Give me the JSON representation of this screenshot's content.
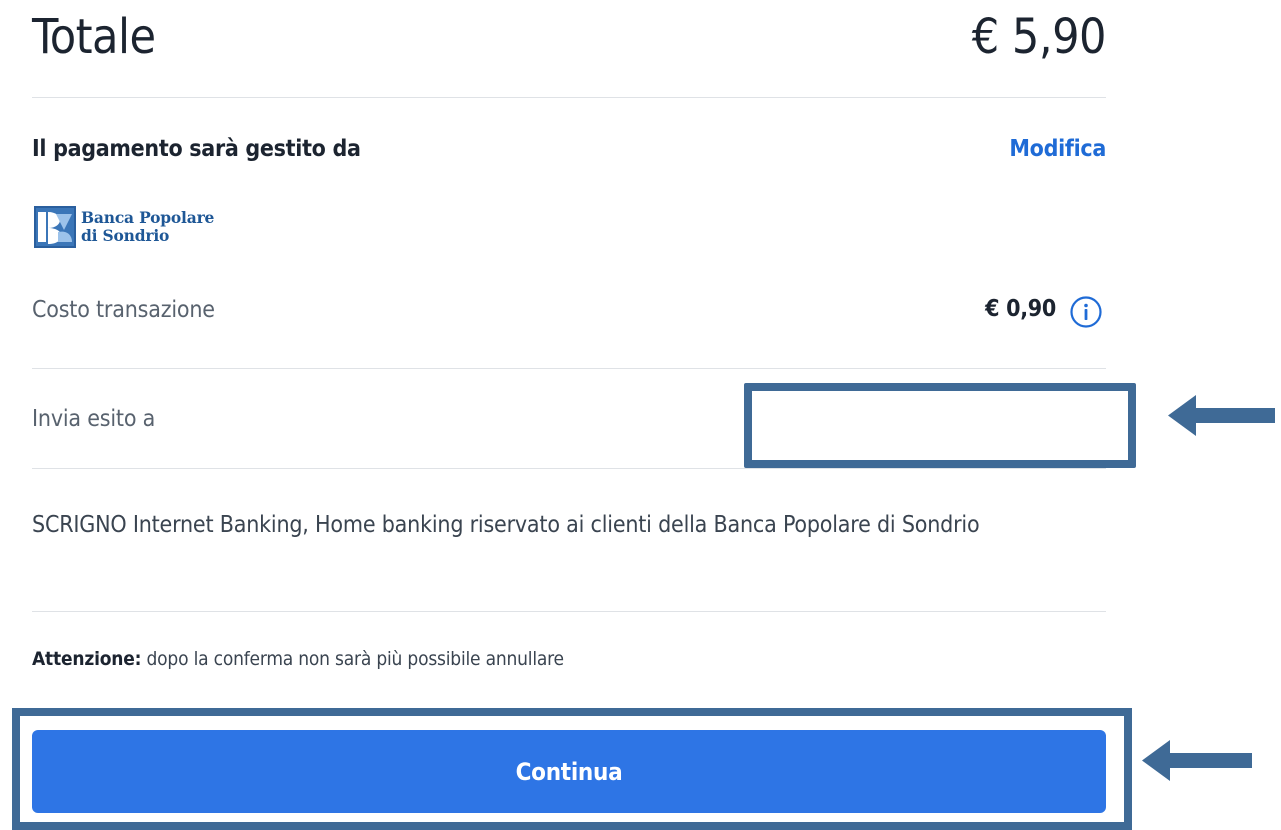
{
  "summary": {
    "total_label": "Totale",
    "total_amount": "€ 5,90"
  },
  "psp": {
    "heading": "Il pagamento sarà gestito da",
    "edit_label": "Modifica",
    "logo_line1": "Banca Popolare",
    "logo_line2": "di Sondrio",
    "fee_label": "Costo transazione",
    "fee_amount": "€ 0,90",
    "description": "SCRIGNO Internet Banking, Home banking riservato ai clienti della Banca Popolare di Sondrio"
  },
  "outcome": {
    "label": "Invia esito a",
    "email_value": ""
  },
  "warning": {
    "prefix": "Attenzione:",
    "text": " dopo la conferma non sarà più possibile annullare"
  },
  "actions": {
    "continue_label": "Continua"
  },
  "icons": {
    "info": "info-circle-icon",
    "bank_logo": "bps-logo-icon",
    "annotation_arrow": "arrow-left-icon"
  },
  "colors": {
    "primary": "#2e75e5",
    "link": "#1f6bd6",
    "annotation": "#3f6a96",
    "bank_brand": "#1e5796"
  }
}
